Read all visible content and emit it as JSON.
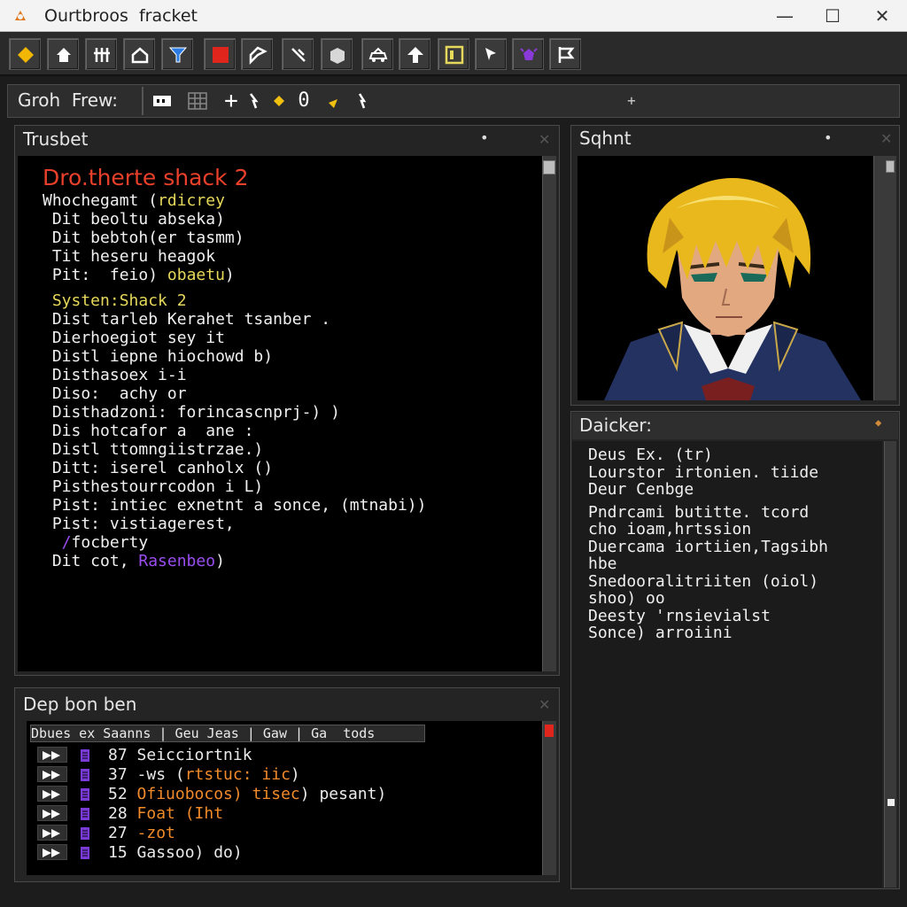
{
  "window": {
    "title": "Ourtbroos  fracket",
    "minimize_glyph": "—",
    "maximize_glyph": "☐",
    "close_glyph": "✕"
  },
  "toolbar": {
    "buttons": [
      {
        "icon": "diamond-icon",
        "color": "#f2b705"
      },
      {
        "icon": "house-icon",
        "color": "#ffffff"
      },
      {
        "icon": "tool-icon",
        "color": "#ffffff"
      },
      {
        "icon": "home-icon",
        "color": "#ffffff"
      },
      {
        "icon": "funnel-icon",
        "color": "#2a7be4"
      },
      {
        "icon": "stop-icon",
        "color": "#e0261c"
      },
      {
        "icon": "export-icon",
        "color": "#ffffff"
      },
      {
        "icon": "brush-icon",
        "color": "#ffffff"
      },
      {
        "icon": "cube-icon",
        "color": "#ffffff"
      },
      {
        "icon": "car-icon",
        "color": "#ffffff"
      },
      {
        "icon": "up-arrow-icon",
        "color": "#ffffff"
      },
      {
        "icon": "panel-icon",
        "color": "#e6d85a"
      },
      {
        "icon": "cursor-icon",
        "color": "#ffffff"
      },
      {
        "icon": "bug-icon",
        "color": "#8a3ad8"
      },
      {
        "icon": "flag-icon",
        "color": "#ffffff"
      }
    ]
  },
  "graphbar": {
    "label": "Groh  Frew:",
    "plus": "+",
    "zero": "0",
    "right_plus": "+"
  },
  "panels": {
    "left_top": {
      "title": "Trusbet",
      "dot": "•",
      "close": "✕",
      "lines": [
        {
          "text": "Dro.therte shack 2",
          "style": "red"
        },
        {
          "text": "Whochegamt (",
          "style": "",
          "tail": "rdicrey",
          "tail_style": "yellow"
        },
        {
          "text": " Dit beoltu abseka)",
          "style": ""
        },
        {
          "text": " Dit bebtoh(er tasmm)",
          "style": ""
        },
        {
          "text": " Tit heseru heagok",
          "style": ""
        },
        {
          "text": " Pit:  feio) ",
          "style": "",
          "tail": "obaetu",
          "tail_style": "yellow",
          "end": ")"
        },
        {
          "text": "",
          "style": ""
        },
        {
          "text": " Systen:Shack 2",
          "style": "yellow"
        },
        {
          "text": " Dist tarleb Kerahet tsanber .",
          "style": ""
        },
        {
          "text": " Dierhoegiot sey it",
          "style": ""
        },
        {
          "text": " Distl iepne hiochowd b)",
          "style": ""
        },
        {
          "text": " Disthasoex i-i",
          "style": ""
        },
        {
          "text": " Diso:  achy or",
          "style": ""
        },
        {
          "text": " Disthadzoni: forincascnprj-) )",
          "style": ""
        },
        {
          "text": " Dis hotcafor a  ane :",
          "style": ""
        },
        {
          "text": " Distl ttomngiistrzae.)",
          "style": ""
        },
        {
          "text": " Ditt: iserel canholx ()",
          "style": ""
        },
        {
          "text": " Pisthestourrcodon i L)",
          "style": ""
        },
        {
          "text": " Pist: intiec exnetnt a sonce, (mtnabi))",
          "style": ""
        },
        {
          "text": " Pist: vistiagerest,",
          "style": ""
        },
        {
          "text": "  /focberty",
          "style": "purple_first"
        },
        {
          "text": " Dit cot, ",
          "style": "",
          "tail": "Rasenbeo",
          "tail_style": "purple",
          "end": ")"
        }
      ]
    },
    "right_top": {
      "title": "Sqhnt",
      "dot": "•",
      "close": "✕"
    },
    "right_mid": {
      "title": "Daicker:",
      "dot": "◆",
      "lines": [
        "Deus Ex. (tr)",
        "Lourstor irtonien. tiide",
        "Deur Cenbge",
        "",
        "Pndrcami butitte. tcord",
        "cho ioam,hrtssion",
        "Duercama iortiien,Tagsibh",
        "hbe",
        "Snedooralitriiten (oiol)",
        "shoo) oo",
        "Deesty 'rnsievialst",
        "Sonce) arroiini"
      ]
    },
    "bottom": {
      "title": "Dep bon ben",
      "close": "✕",
      "header": "Dbues ex Saanns | Geu Jeas | Gaw | Ga  tods",
      "rows": [
        {
          "num": "87",
          "text": "Seicciortnik",
          "text_style": "",
          "rest": ""
        },
        {
          "num": "37",
          "text": "-ws (",
          "text_style": "",
          "mid": "rtstuc: iic",
          "mid_style": "orange",
          "rest": ")"
        },
        {
          "num": "52",
          "text": "Ofiuobocos)",
          "text_style": "orange",
          "mid": " tisec",
          "mid_style": "orange",
          "rest": ") pesant)"
        },
        {
          "num": "28",
          "text": "Foat (Iht",
          "text_style": "orange",
          "rest": ""
        },
        {
          "num": "27",
          "text": "-zot",
          "text_style": "orange",
          "rest": ""
        },
        {
          "num": "15",
          "text": "Gassoo) do)",
          "text_style": "",
          "rest": ""
        }
      ]
    }
  }
}
